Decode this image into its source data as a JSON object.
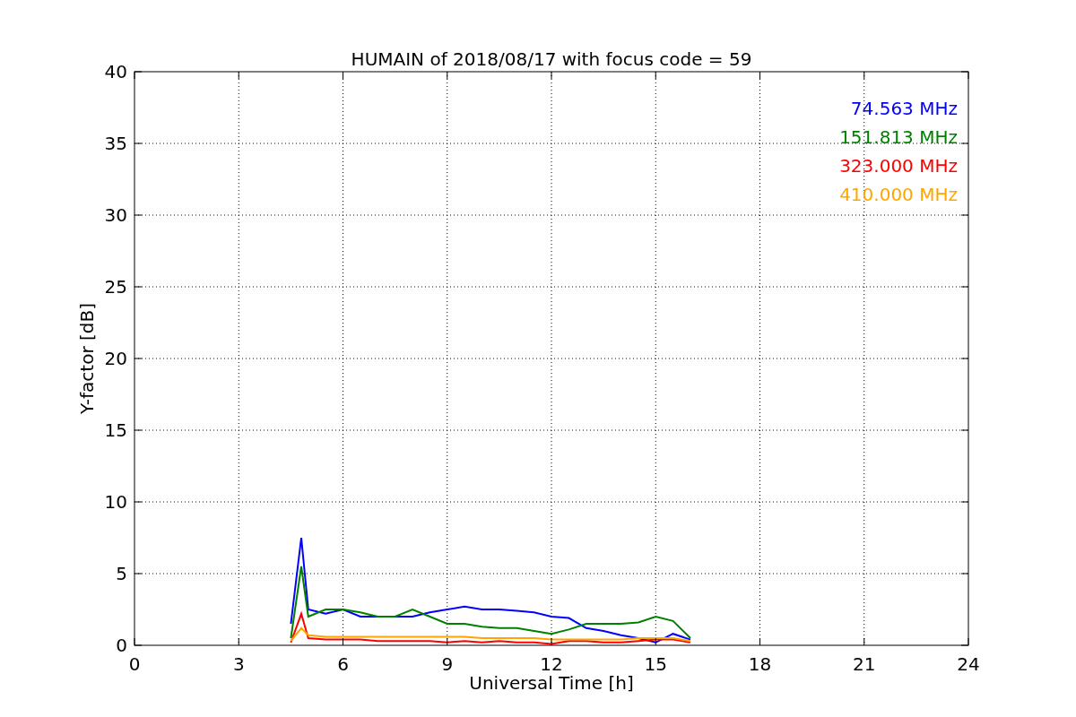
{
  "chart_data": {
    "type": "line",
    "title": "HUMAIN of 2018/08/17 with focus code = 59",
    "xlabel": "Universal Time [h]",
    "ylabel": "Y-factor [dB]",
    "x": [
      4.5,
      4.8,
      5,
      5.5,
      6,
      6.5,
      7,
      7.5,
      8,
      8.5,
      9,
      9.5,
      10,
      10.5,
      11,
      11.5,
      12,
      12.5,
      13,
      13.5,
      14,
      14.5,
      15,
      15.5,
      16
    ],
    "series": [
      {
        "name": "74.563 MHz",
        "color": "#0000ff",
        "values": [
          1.5,
          7.5,
          2.5,
          2.2,
          2.5,
          2,
          2,
          2,
          2,
          2.3,
          2.5,
          2.7,
          2.5,
          2.5,
          2.4,
          2.3,
          2,
          1.9,
          1.2,
          1,
          0.7,
          0.5,
          0.2,
          0.8,
          0.4
        ]
      },
      {
        "name": "151.813 MHz",
        "color": "#008000",
        "values": [
          0.5,
          5.5,
          2,
          2.5,
          2.5,
          2.3,
          2,
          2,
          2.5,
          2,
          1.5,
          1.5,
          1.3,
          1.2,
          1.2,
          1,
          0.8,
          1.1,
          1.5,
          1.5,
          1.5,
          1.6,
          2,
          1.7,
          0.5
        ]
      },
      {
        "name": "323.000 MHz",
        "color": "#ff0000",
        "values": [
          0.2,
          2.2,
          0.5,
          0.4,
          0.4,
          0.4,
          0.3,
          0.3,
          0.3,
          0.3,
          0.2,
          0.3,
          0.2,
          0.3,
          0.2,
          0.2,
          0.1,
          0.3,
          0.3,
          0.2,
          0.2,
          0.3,
          0.4,
          0.4,
          0.2
        ]
      },
      {
        "name": "410.000 MHz",
        "color": "#ffa500",
        "values": [
          0.3,
          1.2,
          0.7,
          0.6,
          0.6,
          0.6,
          0.6,
          0.6,
          0.6,
          0.6,
          0.6,
          0.6,
          0.5,
          0.5,
          0.5,
          0.5,
          0.4,
          0.4,
          0.4,
          0.4,
          0.4,
          0.5,
          0.5,
          0.5,
          0.3
        ]
      }
    ],
    "xlim": [
      0,
      24
    ],
    "ylim": [
      0,
      40
    ],
    "xticks": [
      0,
      3,
      6,
      9,
      12,
      15,
      18,
      21,
      24
    ],
    "yticks": [
      0,
      5,
      10,
      15,
      20,
      25,
      30,
      35,
      40
    ],
    "grid": true
  }
}
